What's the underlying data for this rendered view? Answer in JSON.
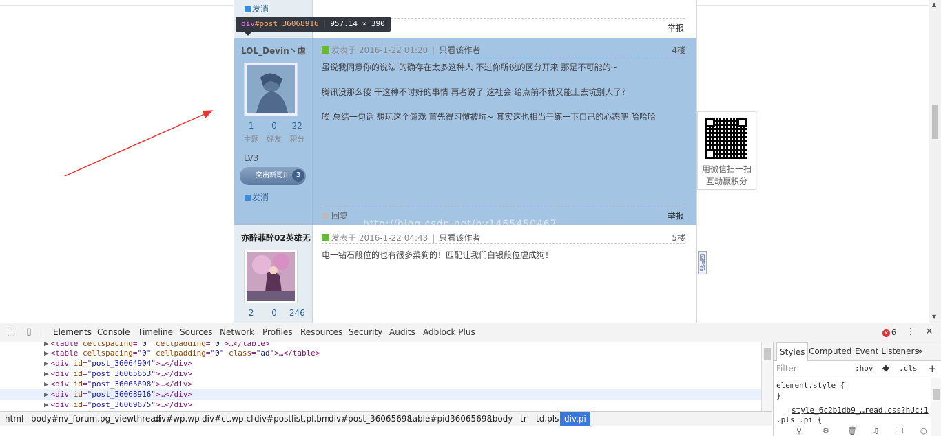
{
  "tooltip": {
    "tag": "div",
    "id": "#post_36068916",
    "size": "957.14 × 390"
  },
  "post_top": {
    "action_label": "发消",
    "report": "举报"
  },
  "post4": {
    "username": "LOL_Devin丶虐",
    "stats": [
      {
        "num": "1",
        "label": "主题"
      },
      {
        "num": "0",
        "label": "好友"
      },
      {
        "num": "22",
        "label": "积分"
      }
    ],
    "level": "LV3",
    "badge_text": "突出新司川",
    "badge_num": "3",
    "message_label": "发消",
    "posted": "发表于 2016-1-22 01:20",
    "only_author": "只看该作者",
    "floor": "4楼",
    "lines": [
      "虽说我同意你的说法 的确存在太多这种人  不过你所说的区分开来 那是不可能的~",
      "腾讯没那么傻 干这种不讨好的事情  再者说了 这社会 给点前不就又能上去坑别人了？",
      "唉  总结一句话  想玩这个游戏  首先得习惯被坑~ 其实这也相当于练一下自己的心态吧 哈哈哈"
    ],
    "reply": "回复",
    "report": "举报"
  },
  "post5": {
    "username": "亦醉菲醉02英雄无",
    "stats": [
      {
        "num": "2"
      },
      {
        "num": "0"
      },
      {
        "num": "246"
      }
    ],
    "posted": "发表于 2016-1-22 04:43",
    "only_author": "只看该作者",
    "floor": "5楼",
    "line": "电一钻石段位的也有很多菜狗的！匹配让我们白银段位虐成狗！"
  },
  "qr": {
    "line1": "用微信扫一扫",
    "line2": "互动赢积分"
  },
  "side_tab": "回顶部",
  "watermark": "http://blog.csdn.net/hy1465450467",
  "devtools": {
    "tabs": [
      "Elements",
      "Console",
      "Timeline",
      "Sources",
      "Network",
      "Profiles",
      "Resources",
      "Security",
      "Audits",
      "Adblock Plus"
    ],
    "error_count": "6",
    "dom_lines": [
      {
        "pre": "<table ",
        "attrs": [
          [
            "cellspacing",
            "0"
          ],
          [
            "cellpadding",
            "0"
          ]
        ],
        "post": ">…</table>"
      },
      {
        "pre": "<table ",
        "attrs": [
          [
            "cellspacing",
            "0"
          ],
          [
            "cellpadding",
            "0"
          ],
          [
            "class",
            "ad"
          ]
        ],
        "post": ">…</table>"
      },
      {
        "pre": "<div ",
        "attrs": [
          [
            "id",
            "post_36064904"
          ]
        ],
        "post": ">…</div>"
      },
      {
        "pre": "<div ",
        "attrs": [
          [
            "id",
            "post_36065653"
          ]
        ],
        "post": ">…</div>"
      },
      {
        "pre": "<div ",
        "attrs": [
          [
            "id",
            "post_36065698"
          ]
        ],
        "post": ">…</div>"
      },
      {
        "pre": "<div ",
        "attrs": [
          [
            "id",
            "post_36068916"
          ]
        ],
        "post": ">…</div>"
      },
      {
        "pre": "<div ",
        "attrs": [
          [
            "id",
            "post_36069675"
          ]
        ],
        "post": ">…</div>"
      }
    ],
    "breadcrumbs": [
      "html",
      "body#nv_forum.pg_viewthread",
      "div#wp.wp",
      "div#ct.wp.cl",
      "div#postlist.pl.bm",
      "div#post_36065698",
      "table#pid36065698",
      "tbody",
      "tr",
      "td.pls",
      "div.pi"
    ],
    "styles": {
      "tabs": [
        "Styles",
        "Computed",
        "Event Listeners"
      ],
      "more": "»",
      "filter_placeholder": "Filter",
      "hov": ":hov",
      "cls": ".cls",
      "plus": "+",
      "element_style_open": "element.style {",
      "element_style_close": "}",
      "source_link": "style_6c2b1db9_…read.css?hUc:1",
      "rule": ".pls .pi {"
    }
  }
}
